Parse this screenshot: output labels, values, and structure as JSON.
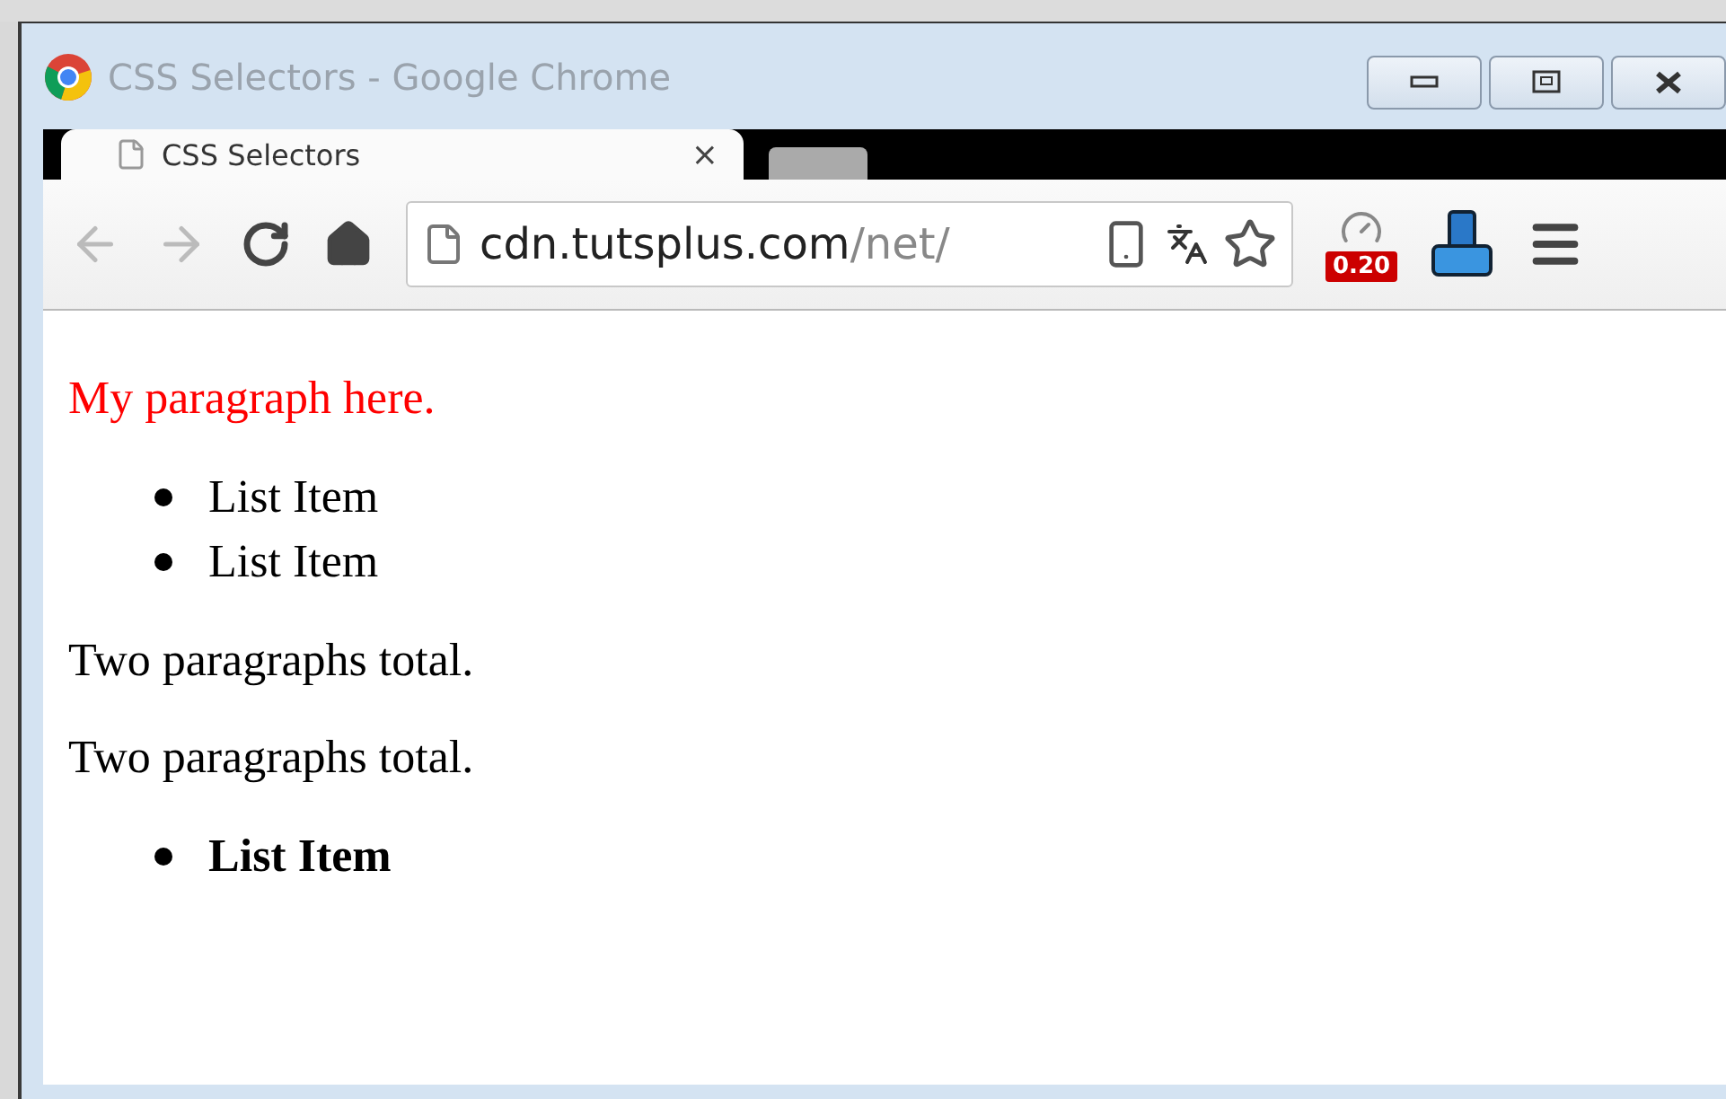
{
  "window": {
    "title": "CSS Selectors - Google Chrome"
  },
  "tabs": [
    {
      "label": "CSS Selectors",
      "selected": true,
      "close": "×"
    }
  ],
  "toolbar": {
    "url_host": "cdn.tutsplus.com",
    "url_path": "/net/",
    "extension_badge": "0.20"
  },
  "content": [
    {
      "kind": "paragraph",
      "text": "My paragraph here.",
      "color": "#ff0000"
    },
    {
      "kind": "list",
      "items": [
        {
          "text": "List Item",
          "bold": false
        },
        {
          "text": "List Item",
          "bold": false
        }
      ]
    },
    {
      "kind": "paragraph",
      "text": "Two paragraphs total.",
      "color": "#000000"
    },
    {
      "kind": "paragraph",
      "text": "Two paragraphs total.",
      "color": "#000000"
    },
    {
      "kind": "list",
      "items": [
        {
          "text": "List Item",
          "bold": true
        }
      ]
    }
  ]
}
